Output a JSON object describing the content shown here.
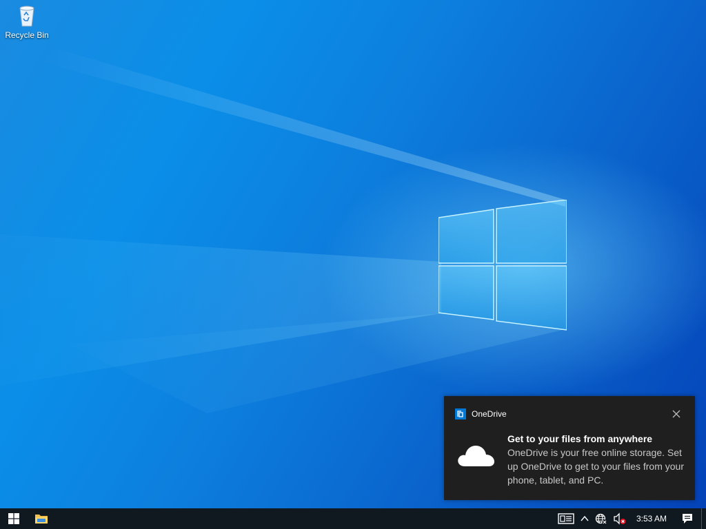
{
  "desktop": {
    "icons": [
      {
        "label": "Recycle Bin",
        "icon": "recycle-bin-icon"
      }
    ]
  },
  "taskbar": {
    "start_icon": "windows-logo-icon",
    "pinned": [
      {
        "icon": "file-explorer-icon"
      }
    ],
    "tray": {
      "icons": [
        "news-and-interests-icon",
        "show-hidden-icons-chevron",
        "network-icon",
        "volume-muted-icon"
      ],
      "clock": "3:53 AM",
      "notifications_icon": "action-center-icon"
    }
  },
  "toast": {
    "app_name": "OneDrive",
    "title": "Get to your files from anywhere",
    "body": "OneDrive is your free online storage. Set up OneDrive to get to your files from your phone, tablet, and PC.",
    "colors": {
      "background": "#1f1f1f",
      "title": "#ffffff",
      "body": "#c8c8c8",
      "accent": "#0078d4"
    }
  },
  "colors": {
    "taskbar": "#101820",
    "wallpaper_primary": "#0a8ee8",
    "wallpaper_dark": "#0442b8"
  }
}
